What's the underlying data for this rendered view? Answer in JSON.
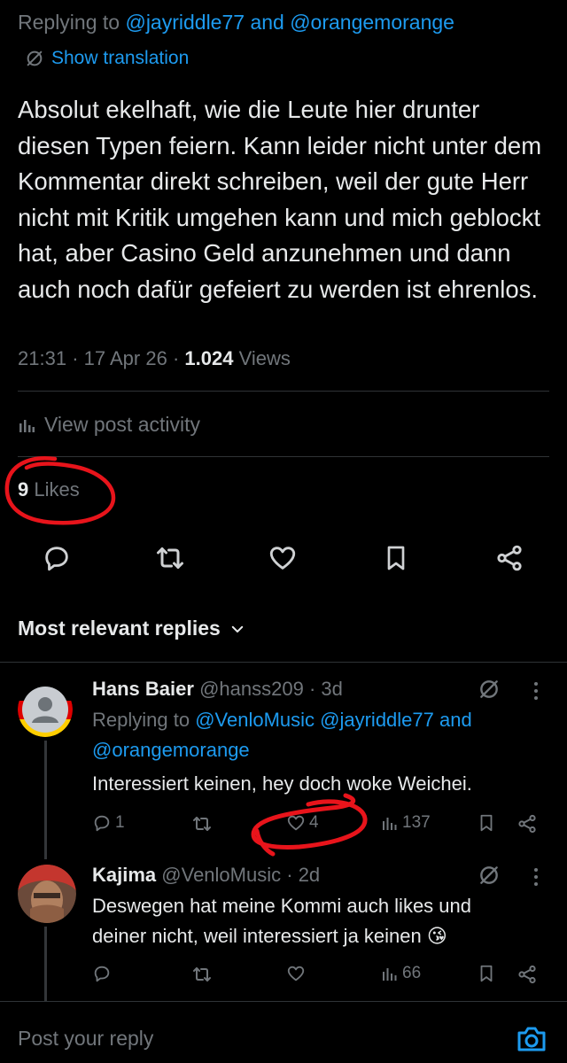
{
  "main_post": {
    "replying_prefix": "Replying to",
    "replying_users": "@jayriddle77 and @orangemorange",
    "translate_label": "Show translation",
    "text": "Absolut ekelhaft, wie die Leute hier drunter diesen Typen feiern. Kann leider nicht unter dem Kommentar direkt schreiben, weil der gute Herr nicht mit Kritik umgehen kann und mich geblockt hat, aber Casino Geld anzunehmen und dann auch noch dafür gefeiert zu werden ist ehrenlos.",
    "time": "21:31",
    "date": "17 Apr 26",
    "views_count": "1.024",
    "views_label": "Views",
    "activity_label": "View post activity",
    "likes_count": "9",
    "likes_label": "Likes"
  },
  "replies_sort": {
    "label": "Most relevant replies"
  },
  "replies": [
    {
      "name": "Hans Baier",
      "handle": "@hanss209",
      "age": "· 3d",
      "replying_prefix": "Replying to",
      "replying_users_line1": "@VenloMusic @jayriddle77 and",
      "replying_users_line2": "@orangemorange",
      "text": "Interessiert keinen, hey doch woke Weichei.",
      "reply_count": "1",
      "like_count": "4",
      "view_count": "137"
    },
    {
      "name": "Kajima",
      "handle": "@VenloMusic",
      "age": "· 2d",
      "text_line1": "Deswegen hat meine Kommi auch likes und",
      "text_line2": "deiner nicht, weil interessiert ja keinen 😘",
      "view_count": "66"
    }
  ],
  "composer": {
    "placeholder": "Post your reply"
  },
  "colors": {
    "background": "#000000",
    "text": "#e7e9ea",
    "muted": "#71767b",
    "accent": "#1d9bf0",
    "scribble": "#e8141b",
    "divider": "#2f3336"
  },
  "icons": [
    "translate-icon",
    "activity-icon",
    "reply-icon",
    "repost-icon",
    "like-icon",
    "bookmark-icon",
    "share-icon",
    "chevron-down-icon",
    "grok-icon",
    "more-icon",
    "camera-icon"
  ]
}
